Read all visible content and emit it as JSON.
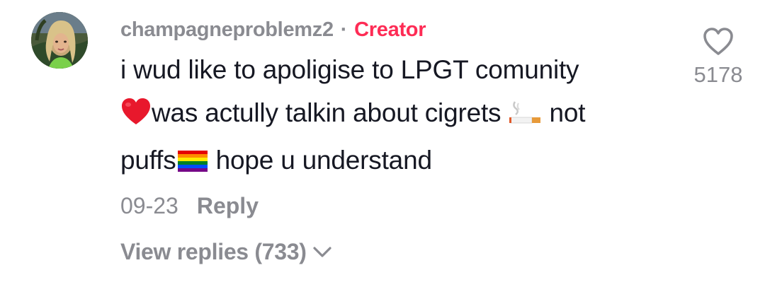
{
  "comment": {
    "username": "champagneproblemz2",
    "separator": "·",
    "badge": "Creator",
    "text": {
      "line1": "i wud like to apoligise to LPGT comunity",
      "line2_after_heart": "was actully talkin about cigrets",
      "line2_after_cigarette": " not",
      "line3_before_flag": "puffs",
      "line3_after_flag": " hope u understand"
    },
    "date": "09-23",
    "reply_label": "Reply",
    "view_replies": "View replies (733)",
    "like_count": "5178",
    "emojis": [
      "red-heart-emoji",
      "cigarette-emoji",
      "rainbow-flag-emoji"
    ]
  },
  "colors": {
    "username": "#8a8b91",
    "creator_badge": "#fe2c55",
    "body_text": "#161823",
    "meta": "#8a8b91"
  }
}
